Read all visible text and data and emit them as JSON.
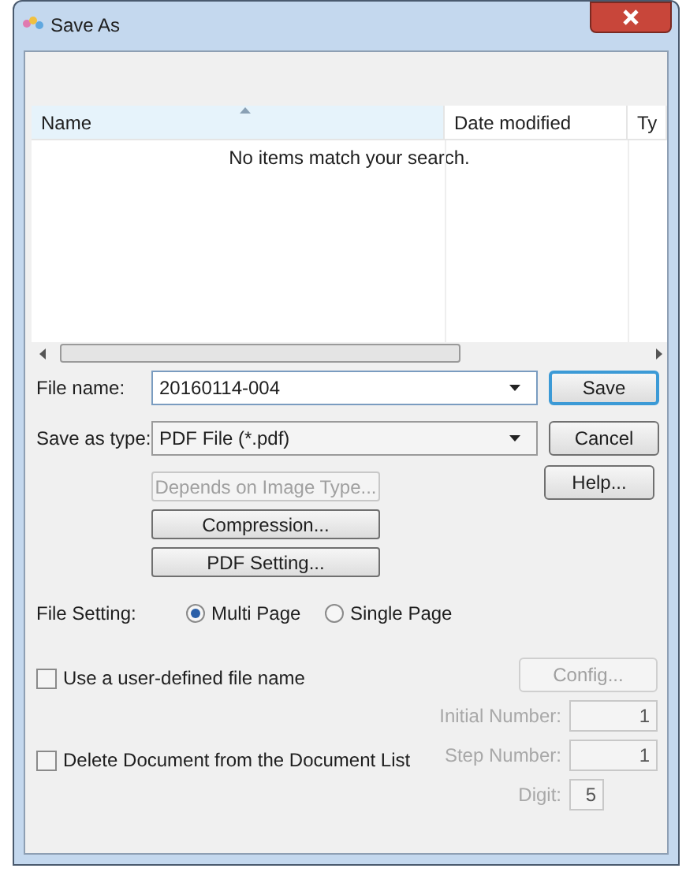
{
  "window": {
    "title": "Save As"
  },
  "file_list": {
    "columns": [
      {
        "label": "Name",
        "sorted": true
      },
      {
        "label": "Date modified",
        "sorted": false
      },
      {
        "label": "Ty",
        "sorted": false
      }
    ],
    "empty_message": "No items match your search."
  },
  "fields": [
    {
      "label": "File name:",
      "value": "20160114-004"
    },
    {
      "label": "Save as type:",
      "value": "PDF File (*.pdf)"
    }
  ],
  "buttons": [
    {
      "label": "Save",
      "default": true
    },
    {
      "label": "Cancel",
      "default": false
    },
    {
      "label": "Help...",
      "default": false
    }
  ],
  "option_buttons": [
    {
      "label": "Depends on Image Type...",
      "disabled": true
    },
    {
      "label": "Compression...",
      "disabled": false
    },
    {
      "label": "PDF Setting...",
      "disabled": false
    }
  ],
  "file_setting": {
    "label": "File Setting:",
    "options": [
      {
        "label": "Multi Page",
        "selected": true
      },
      {
        "label": "Single Page",
        "selected": false
      }
    ]
  },
  "checkboxes": [
    {
      "label": "Use a user-defined file name",
      "checked": false
    },
    {
      "label": "Delete Document from the Document List",
      "checked": false
    }
  ],
  "config_button": {
    "label": "Config...",
    "disabled": true
  },
  "number_fields": [
    {
      "label": "Initial Number:",
      "value": "1",
      "disabled": true
    },
    {
      "label": "Step Number:",
      "value": "1",
      "disabled": true
    },
    {
      "label": "Digit:",
      "value": "5",
      "disabled": true
    }
  ]
}
